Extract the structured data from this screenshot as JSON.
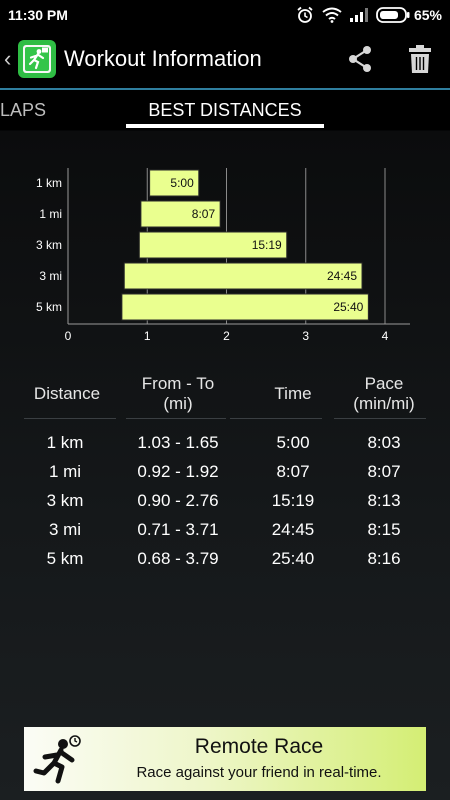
{
  "status_bar": {
    "time": "11:30 PM",
    "battery_text": "65%"
  },
  "app_bar": {
    "back_glyph": "‹",
    "title": "Workout Information",
    "actions": [
      "share-icon",
      "trash-icon"
    ],
    "divider_color": "#2f7f9f"
  },
  "tabs": [
    {
      "label": "LAPS",
      "selected": false
    },
    {
      "label": "BEST DISTANCES",
      "selected": true
    }
  ],
  "chart_data": {
    "type": "bar",
    "orientation": "horizontal-range",
    "categories": [
      "1 km",
      "1 mi",
      "3 km",
      "3 mi",
      "5 km"
    ],
    "ranges": [
      [
        1.03,
        1.65
      ],
      [
        0.92,
        1.92
      ],
      [
        0.9,
        2.76
      ],
      [
        0.71,
        3.71
      ],
      [
        0.68,
        3.79
      ]
    ],
    "labels": [
      "5:00",
      "8:07",
      "15:19",
      "24:45",
      "25:40"
    ],
    "xlim": [
      0,
      4
    ],
    "xticks": [
      "0",
      "1",
      "2",
      "3",
      "4"
    ],
    "grid": true,
    "bar_color": "#eaff8f"
  },
  "table": {
    "headers": [
      {
        "line1": "Distance",
        "line2": ""
      },
      {
        "line1": "From - To",
        "line2": "(mi)"
      },
      {
        "line1": "Time",
        "line2": ""
      },
      {
        "line1": "Pace",
        "line2": "(min/mi)"
      }
    ],
    "rows": [
      [
        "1 km",
        "1.03 - 1.65",
        "5:00",
        "8:03"
      ],
      [
        "1 mi",
        "0.92 - 1.92",
        "8:07",
        "8:07"
      ],
      [
        "3 km",
        "0.90 - 2.76",
        "15:19",
        "8:13"
      ],
      [
        "3 mi",
        "0.71 - 3.71",
        "24:45",
        "8:15"
      ],
      [
        "5 km",
        "0.68 - 3.79",
        "25:40",
        "8:16"
      ]
    ]
  },
  "banner": {
    "title": "Remote Race",
    "subtitle": "Race against your friend in real-time.",
    "icon": "running-man-icon"
  }
}
